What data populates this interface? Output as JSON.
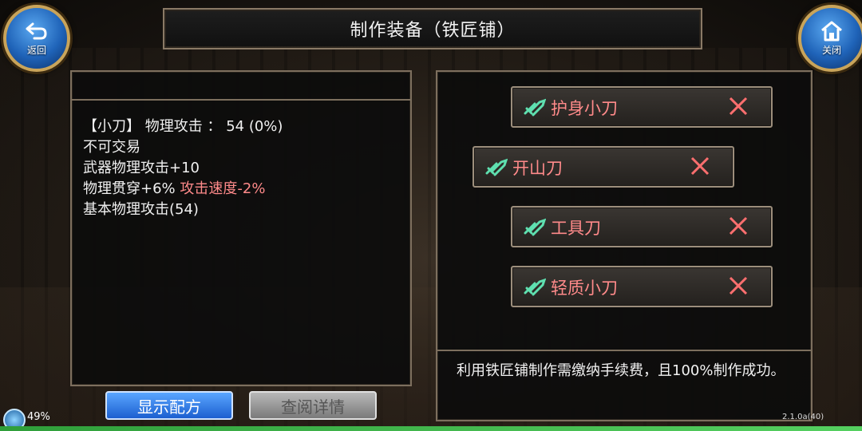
{
  "header": {
    "title": "制作装备（铁匠铺）",
    "back_label": "返回",
    "close_label": "关闭"
  },
  "item_stats": {
    "line1_name": "【小刀】",
    "line1_attr": "物理攻击 ：",
    "line1_value": "54 (0%)",
    "line2": "不可交易",
    "line3": "武器物理攻击+10",
    "line4_a": "物理贯穿+6%",
    "line4_b": "攻击速度-2%",
    "line5": "基本物理攻击(54)"
  },
  "recipes": [
    {
      "name": "护身小刀"
    },
    {
      "name": "开山刀"
    },
    {
      "name": "工具刀"
    },
    {
      "name": "轻质小刀"
    }
  ],
  "description": "利用铁匠铺制作需缴纳手续费，且100%制作成功。",
  "buttons": {
    "show_recipe": "显示配方",
    "view_detail": "查阅详情"
  },
  "status": {
    "battery": "49%",
    "version": "2.1.0a(40)",
    "progress": 1.0
  },
  "colors": {
    "accent_blue": "#1c5fd0",
    "recipe_text": "#ff8a8a",
    "panel_border": "#7d6f5e"
  }
}
